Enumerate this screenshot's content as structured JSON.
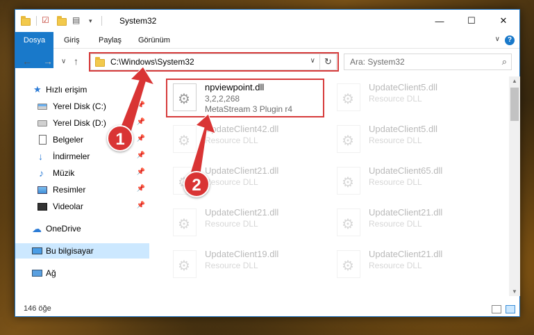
{
  "window": {
    "title": "System32",
    "buttons": {
      "minimize": "—",
      "maximize": "☐",
      "close": "✕"
    }
  },
  "ribbon": {
    "tabs": [
      {
        "label": "Dosya"
      },
      {
        "label": "Giriş"
      },
      {
        "label": "Paylaş"
      },
      {
        "label": "Görünüm"
      }
    ],
    "expand_glyph": "∨",
    "help_glyph": "?"
  },
  "navbar": {
    "back": "←",
    "forward": "→",
    "recent": "∨",
    "up": "↑",
    "address": "C:\\Windows\\System32",
    "address_dropdown": "∨",
    "refresh": "↻",
    "search_placeholder": "Ara: System32",
    "search_icon": "⌕"
  },
  "sidebar": {
    "items": [
      {
        "label": "Hızlı erişim",
        "icon": "star-icon",
        "pinned": false
      },
      {
        "label": "Yerel Disk (C:)",
        "icon": "drive-c-icon",
        "pinned": true
      },
      {
        "label": "Yerel Disk (D:)",
        "icon": "drive-d-icon",
        "pinned": true
      },
      {
        "label": "Belgeler",
        "icon": "documents-icon",
        "pinned": true
      },
      {
        "label": "İndirmeler",
        "icon": "downloads-icon",
        "pinned": true
      },
      {
        "label": "Müzik",
        "icon": "music-icon",
        "pinned": true
      },
      {
        "label": "Resimler",
        "icon": "pictures-icon",
        "pinned": true
      },
      {
        "label": "Videolar",
        "icon": "videos-icon",
        "pinned": true
      },
      {
        "label": "OneDrive",
        "icon": "onedrive-icon",
        "pinned": false
      },
      {
        "label": "Bu bilgisayar",
        "icon": "this-pc-icon",
        "pinned": false,
        "selected": true
      },
      {
        "label": "Ağ",
        "icon": "network-icon",
        "pinned": false
      }
    ],
    "pin_glyph": "📌"
  },
  "files": [
    {
      "name": "npviewpoint.dll",
      "line2": "3,2,2,268",
      "line3": "MetaStream 3 Plugin r4",
      "highlighted": true
    },
    {
      "name": "UpdateClient5.dll",
      "line2": "Resource DLL"
    },
    {
      "name": "UpdateClient42.dll",
      "line2": "Resource DLL"
    },
    {
      "name": "UpdateClient5.dll",
      "line2": "Resource DLL"
    },
    {
      "name": "UpdateClient21.dll",
      "line2": "Resource DLL"
    },
    {
      "name": "UpdateClient65.dll",
      "line2": "Resource DLL"
    },
    {
      "name": "UpdateClient21.dll",
      "line2": "Resource DLL"
    },
    {
      "name": "UpdateClient21.dll",
      "line2": "Resource DLL"
    },
    {
      "name": "UpdateClient19.dll",
      "line2": "Resource DLL"
    },
    {
      "name": "UpdateClient21.dll",
      "line2": "Resource DLL"
    }
  ],
  "statusbar": {
    "count": "146 öğe"
  },
  "annotations": {
    "badge1": "1",
    "badge2": "2",
    "color": "#d63a3a"
  }
}
